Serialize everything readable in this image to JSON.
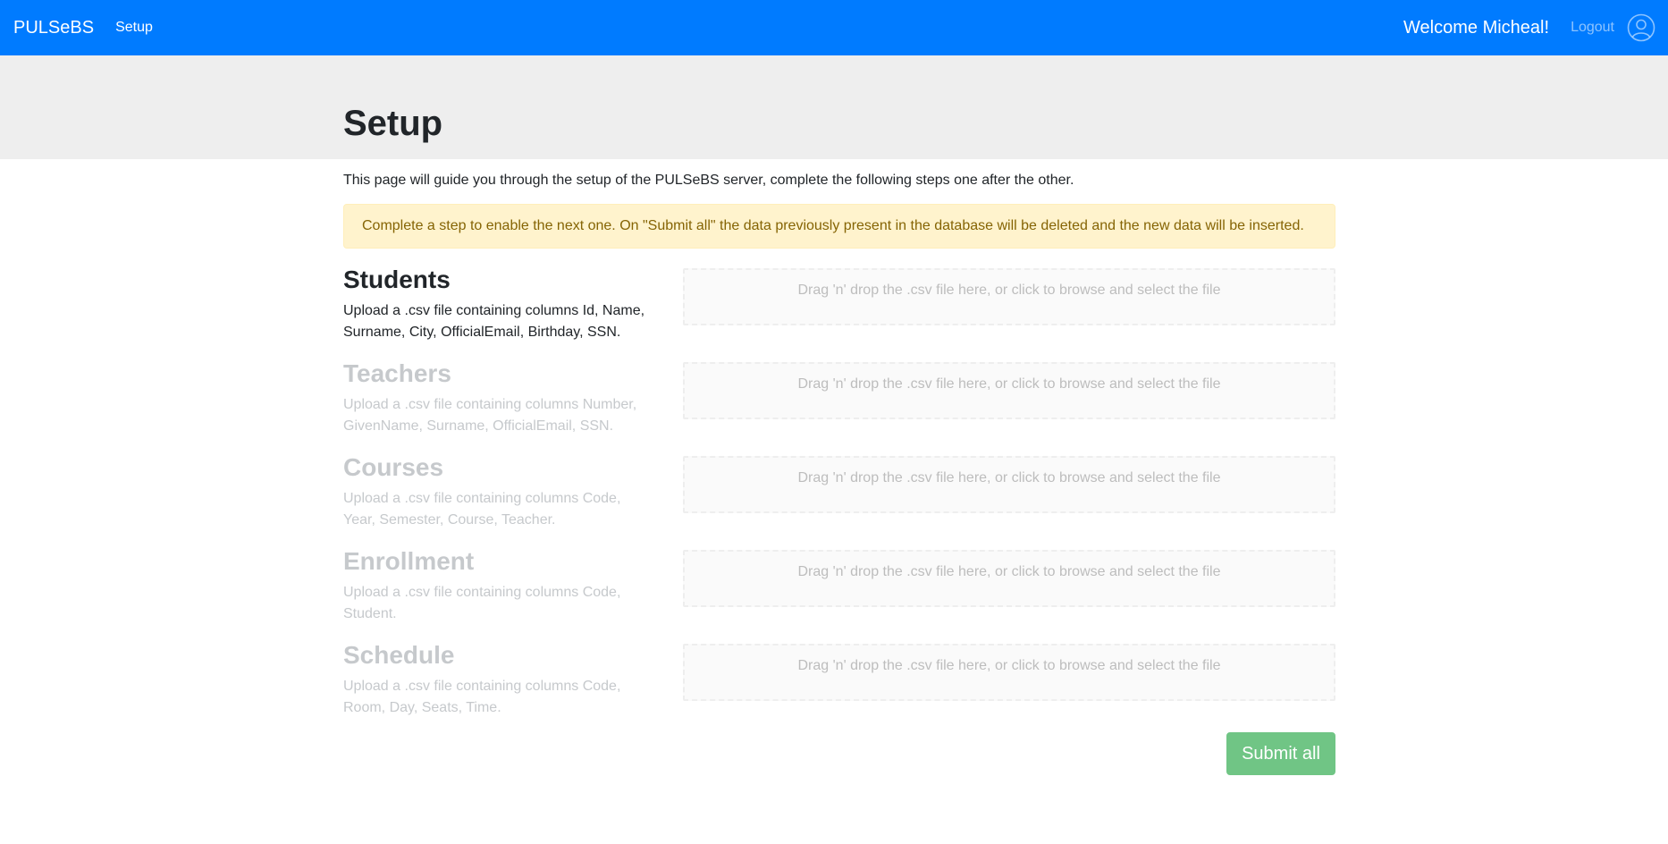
{
  "navbar": {
    "brand": "PULSeBS",
    "link": "Setup",
    "welcome": "Welcome Micheal!",
    "logout": "Logout",
    "user_icon": "user-circle-icon",
    "color": "#007bff"
  },
  "page": {
    "title": "Setup",
    "intro": "This page will guide you through the setup of the PULSeBS server, complete the following steps one after the other.",
    "alert": "Complete a step to enable the next one. On \"Submit all\" the data previously present in the database will be deleted and the new data will be inserted."
  },
  "steps": [
    {
      "title": "Students",
      "desc": "Upload a .csv file containing columns Id, Name, Surname, City, OfficialEmail, Birthday, SSN.",
      "dropzone": "Drag 'n' drop the .csv file here, or click to browse and select the file",
      "enabled": true
    },
    {
      "title": "Teachers",
      "desc": "Upload a .csv file containing columns Number, GivenName, Surname, OfficialEmail, SSN.",
      "dropzone": "Drag 'n' drop the .csv file here, or click to browse and select the file",
      "enabled": false
    },
    {
      "title": "Courses",
      "desc": "Upload a .csv file containing columns Code, Year, Semester, Course, Teacher.",
      "dropzone": "Drag 'n' drop the .csv file here, or click to browse and select the file",
      "enabled": false
    },
    {
      "title": "Enrollment",
      "desc": "Upload a .csv file containing columns Code, Student.",
      "dropzone": "Drag 'n' drop the .csv file here, or click to browse and select the file",
      "enabled": false
    },
    {
      "title": "Schedule",
      "desc": "Upload a .csv file containing columns Code, Room, Day, Seats, Time.",
      "dropzone": "Drag 'n' drop the .csv file here, or click to browse and select the file",
      "enabled": false
    }
  ],
  "actions": {
    "submit_all": "Submit all",
    "submit_color": "#70c585"
  }
}
